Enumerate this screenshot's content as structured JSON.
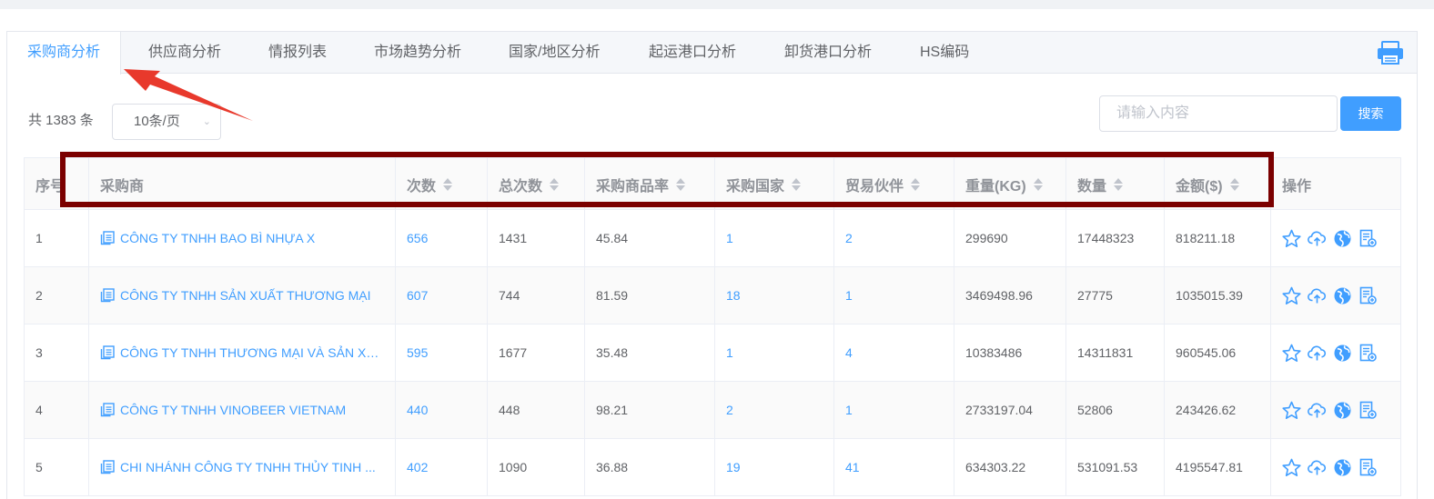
{
  "tabs": [
    {
      "label": "采购商分析",
      "active": true
    },
    {
      "label": "供应商分析"
    },
    {
      "label": "情报列表"
    },
    {
      "label": "市场趋势分析"
    },
    {
      "label": "国家/地区分析"
    },
    {
      "label": "起运港口分析"
    },
    {
      "label": "卸货港口分析"
    },
    {
      "label": "HS编码"
    }
  ],
  "toolbar": {
    "total_text": "共 1383 条",
    "page_size": "10条/页",
    "search_placeholder": "请输入内容",
    "search_button": "搜索"
  },
  "table": {
    "headers": [
      "序号",
      "采购商",
      "次数",
      "总次数",
      "采购商品率",
      "采购国家",
      "贸易伙伴",
      "重量(KG)",
      "数量",
      "金额($)",
      "操作"
    ],
    "rows": [
      {
        "no": "1",
        "buyer": "CÔNG TY TNHH BAO BÌ NHỰA X",
        "count": "656",
        "total": "1431",
        "rate": "45.84",
        "countries": "1",
        "partners": "2",
        "weight": "299690",
        "qty": "17448323",
        "amount": "818211.18"
      },
      {
        "no": "2",
        "buyer": "CÔNG TY TNHH SẢN XUẤT THƯƠNG MẠI",
        "count": "607",
        "total": "744",
        "rate": "81.59",
        "countries": "18",
        "partners": "1",
        "weight": "3469498.96",
        "qty": "27775",
        "amount": "1035015.39"
      },
      {
        "no": "3",
        "buyer": "CÔNG TY TNHH THƯƠNG MẠI VÀ SẢN XUẤT",
        "count": "595",
        "total": "1677",
        "rate": "35.48",
        "countries": "1",
        "partners": "4",
        "weight": "10383486",
        "qty": "14311831",
        "amount": "960545.06"
      },
      {
        "no": "4",
        "buyer": "CÔNG TY TNHH VINOBEER VIETNAM",
        "count": "440",
        "total": "448",
        "rate": "98.21",
        "countries": "2",
        "partners": "1",
        "weight": "2733197.04",
        "qty": "52806",
        "amount": "243426.62"
      },
      {
        "no": "5",
        "buyer": "CHI NHÁNH CÔNG TY TNHH THỦY TINH ...",
        "count": "402",
        "total": "1090",
        "rate": "36.88",
        "countries": "19",
        "partners": "41",
        "weight": "634303.22",
        "qty": "531091.53",
        "amount": "4195547.81"
      }
    ]
  },
  "icons": [
    "print-icon",
    "document-icon",
    "star-icon",
    "cloud-upload-icon",
    "globe-icon",
    "report-icon"
  ],
  "colors": {
    "accent": "#409eff",
    "highlight_box": "#7b0000",
    "arrow": "#e8392c"
  }
}
